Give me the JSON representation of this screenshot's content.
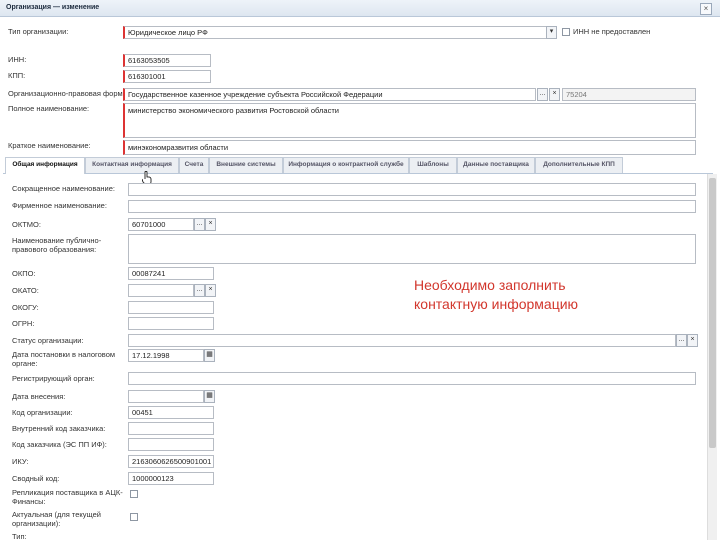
{
  "window": {
    "title": "Организация — изменение",
    "close": "×"
  },
  "header": {
    "org_type_label": "Тип организации:",
    "org_type_value": "Юридическое лицо РФ",
    "no_inn_label": "ИНН не предоставлен",
    "inn_label": "ИНН:",
    "inn_value": "6163053505",
    "kpp_label": "КПП:",
    "kpp_value": "616301001",
    "legal_form_label": "Организационно-правовая форма:",
    "legal_form_value": "Государственное казенное учреждение субъекта Российской Федерации",
    "legal_form_code": "75204",
    "full_name_label": "Полное наименование:",
    "full_name_value": "министерство экономического развития Ростовской области",
    "short_name_label": "Краткое наименование:",
    "short_name_value": "минэкономразвития области"
  },
  "tabs": [
    {
      "label": "Общая информация"
    },
    {
      "label": "Контактная информация"
    },
    {
      "label": "Счета"
    },
    {
      "label": "Внешние системы"
    },
    {
      "label": "Информация о контрактной службе"
    },
    {
      "label": "Шаблоны"
    },
    {
      "label": "Данные поставщика"
    },
    {
      "label": "Дополнительные КПП"
    }
  ],
  "form": {
    "abbr_name_label": "Сокращенное наименование:",
    "firm_name_label": "Фирменное наименование:",
    "oktmo_label": "ОКТМО:",
    "oktmo_value": "60701000",
    "public_entity_label": "Наименование публично-правового образования:",
    "okpo_label": "ОКПО:",
    "okpo_value": "00087241",
    "okato_label": "ОКАТО:",
    "okogu_label": "ОКОГУ:",
    "ogrn_label": "ОГРН:",
    "status_label": "Статус организации:",
    "tax_date_label": "Дата постановки в налоговом органе:",
    "tax_date_value": "17.12.1998",
    "reg_organ_label": "Регистрирующий орган:",
    "reg_date_label": "Дата внесения:",
    "org_code_label": "Код организации:",
    "org_code_value": "00451",
    "internal_code_label": "Внутренний код заказчика:",
    "customer_code_label": "Код заказчика (ЭС ПП ИФ):",
    "iku_label": "ИКУ:",
    "iku_value": "2163060626500901001",
    "sv_code_label": "Сводный код:",
    "sv_code_value": "1000000123",
    "replication_label": "Репликация поставщика в АЦК-Финансы:",
    "actual_label": "Актуальная (для текущей организации):",
    "extra_label": "Тип:"
  },
  "button_glyph": "...",
  "calendar_glyph": "▦",
  "dropdown_glyph": "▾",
  "annotation": "Необходимо заполнить\nконтактную информацию",
  "colors": {
    "annotation": "#d2372d",
    "required_border": "#dd3333"
  }
}
